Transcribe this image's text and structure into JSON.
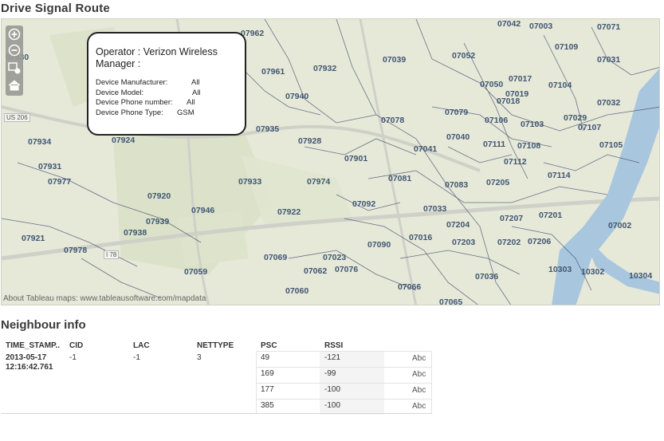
{
  "page": {
    "title": "Drive Signal Route"
  },
  "map": {
    "attribution": "About Tableau maps: www.tableausoftware.com/mapdata",
    "colors": {
      "land": "#e6e8d8",
      "green": "#d5dfc2",
      "water": "#a8c6dd",
      "border": "#3e4a6a",
      "road": "#cfd0c8"
    },
    "road_labels": [
      "US 206",
      "I 78"
    ],
    "zip_codes": [
      "07930",
      "07962",
      "07042",
      "07003",
      "07071",
      "07934",
      "07924",
      "07931",
      "07977",
      "07920",
      "07939",
      "07938",
      "07921",
      "07978",
      "07946",
      "07059",
      "07961",
      "07932",
      "07940",
      "07935",
      "07928",
      "07933",
      "07922",
      "07069",
      "07060",
      "07039",
      "07052",
      "07050",
      "07017",
      "07109",
      "07031",
      "07019",
      "07104",
      "07018",
      "07032",
      "07078",
      "07079",
      "07106",
      "07029",
      "07103",
      "07040",
      "07107",
      "07111",
      "07108",
      "07041",
      "07105",
      "07901",
      "07974",
      "07081",
      "07092",
      "07112",
      "07083",
      "07114",
      "07205",
      "07033",
      "07204",
      "07207",
      "07201",
      "07016",
      "07090",
      "07023",
      "07203",
      "07202",
      "07206",
      "07062",
      "07076",
      "07036",
      "07002",
      "10303",
      "10302",
      "10304",
      "07066",
      "07065"
    ]
  },
  "tooltip": {
    "operator": "Operator : Verizon Wireless Manager :",
    "rows": [
      {
        "label": "Device Manufacturer:",
        "value": "All"
      },
      {
        "label": "Device Model:",
        "value": "All"
      },
      {
        "label": "Device Phone number:",
        "value": "All"
      },
      {
        "label": "Device Phone Type:",
        "value": "GSM"
      }
    ]
  },
  "map_tools": [
    "zoom-in-icon",
    "zoom-out-icon",
    "select-region-icon",
    "home-icon"
  ],
  "neighbour": {
    "heading": "Neighbour info",
    "columns": [
      "TIME_STAMP..",
      "CID",
      "LAC",
      "NETTYPE",
      "PSC",
      "RSSI"
    ],
    "row": {
      "timestamp_date": "2013-05-17",
      "timestamp_time": "12:16:42.761",
      "cid": "-1",
      "lac": "-1",
      "nettype": "3"
    },
    "sub_rows": [
      {
        "psc": "49",
        "rssi": "-121",
        "marker": "Abc"
      },
      {
        "psc": "169",
        "rssi": "-99",
        "marker": "Abc"
      },
      {
        "psc": "177",
        "rssi": "-100",
        "marker": "Abc"
      },
      {
        "psc": "385",
        "rssi": "-100",
        "marker": "Abc"
      }
    ]
  }
}
